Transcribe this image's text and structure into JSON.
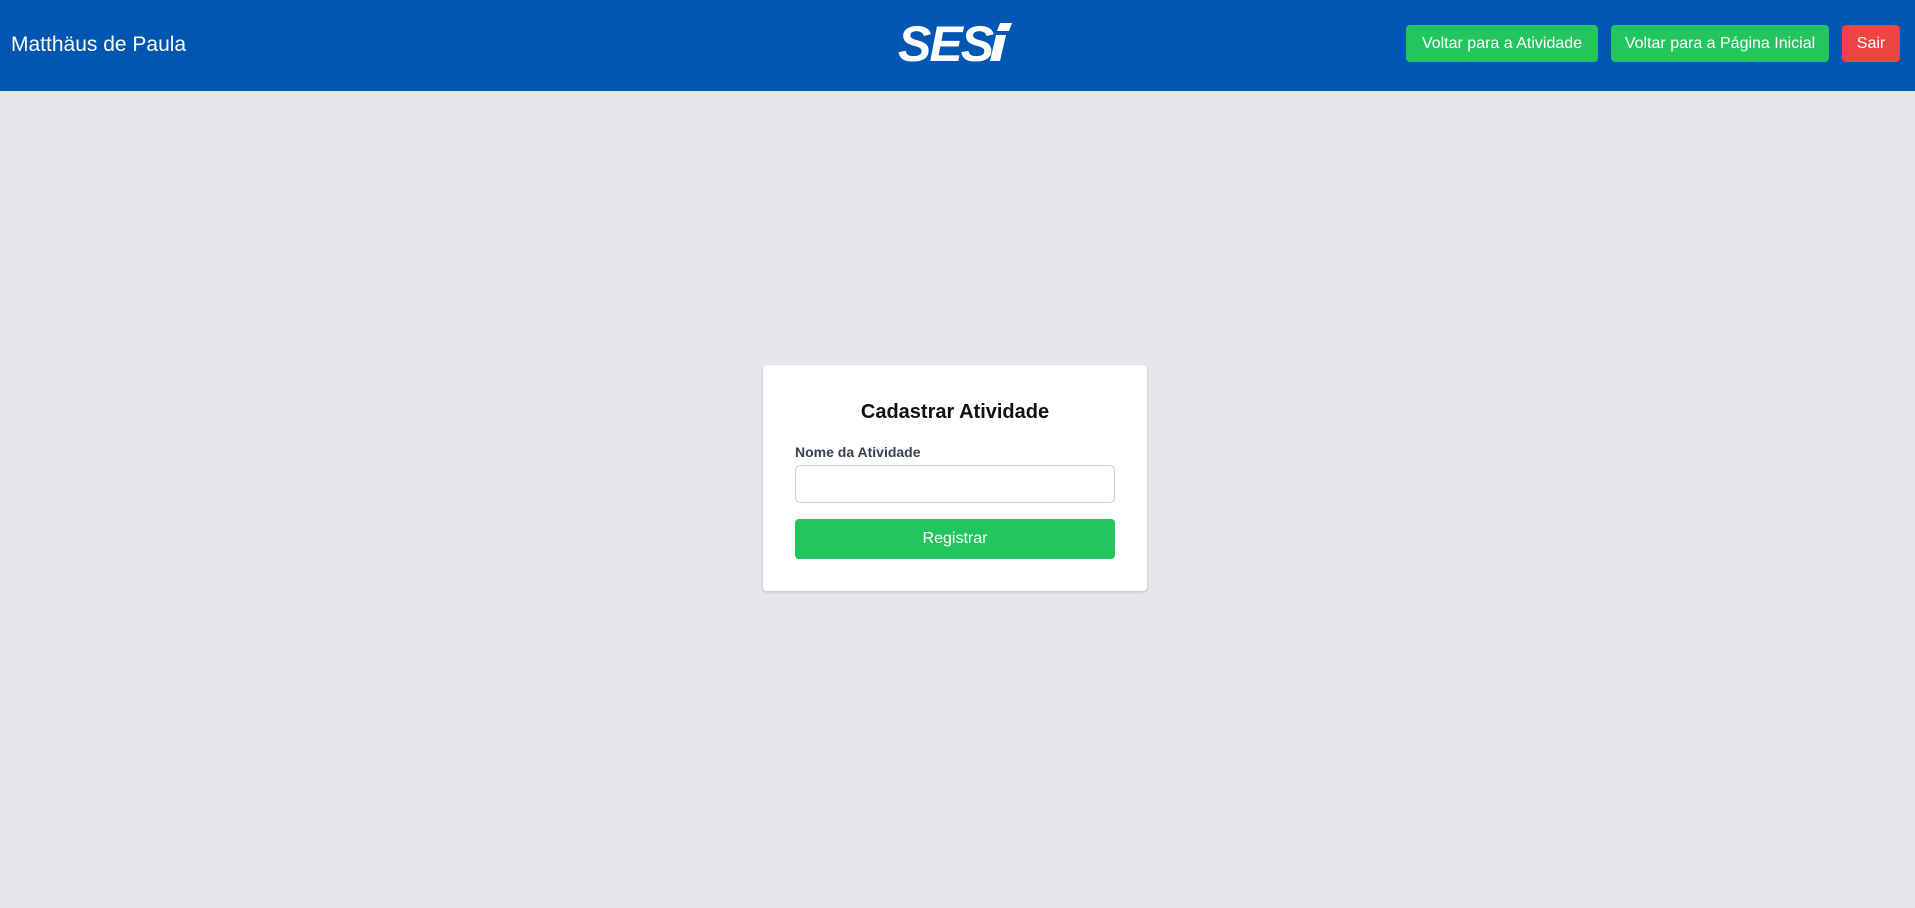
{
  "header": {
    "user_name": "Matthäus de Paula",
    "logo_text": "SESI",
    "buttons": {
      "back_to_activity": "Voltar para a Atividade",
      "back_to_home": "Voltar para a Página Inicial",
      "logout": "Sair"
    }
  },
  "form": {
    "title": "Cadastrar Atividade",
    "activity_name_label": "Nome da Atividade",
    "activity_name_value": "",
    "activity_name_placeholder": "",
    "submit_label": "Registrar"
  },
  "colors": {
    "header_bg": "#0056b3",
    "page_bg": "#e5e7eb",
    "primary_green": "#22c55e",
    "danger_red": "#ef4444"
  }
}
